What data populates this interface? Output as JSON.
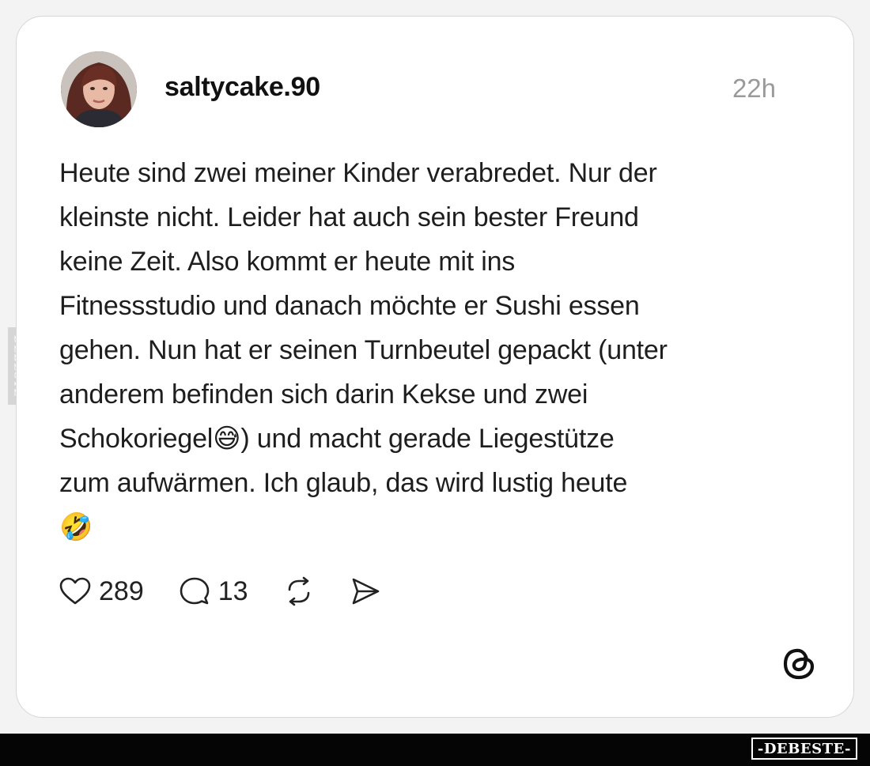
{
  "post": {
    "username": "saltycake.90",
    "time": "22h",
    "text": "Heute sind zwei meiner Kinder verabredet. Nur der\nkleinste nicht. Leider hat auch sein bester Freund\nkeine Zeit. Also kommt er heute mit ins\nFitnessstudio und danach möchte er Sushi essen\ngehen. Nun hat er seinen Turnbeutel gepackt (unter\nanderem befinden sich darin Kekse und zwei\nSchokoriegel😅) und macht gerade Liegestütze\nzum aufwärmen. Ich glaub, das wird lustig heute\n🤣"
  },
  "actions": {
    "likes": "289",
    "replies": "13"
  },
  "icons": {
    "like": "heart-icon",
    "reply": "speech-bubble-icon",
    "repost": "repost-icon",
    "share": "send-icon",
    "app": "threads-logo-icon"
  },
  "watermark": {
    "side": "DEBESTE",
    "brand": "-DEBESTE-"
  },
  "colors": {
    "timestamp": "#9a9a9a",
    "text": "#1e1e1e",
    "bottom_bar": "#050505"
  }
}
